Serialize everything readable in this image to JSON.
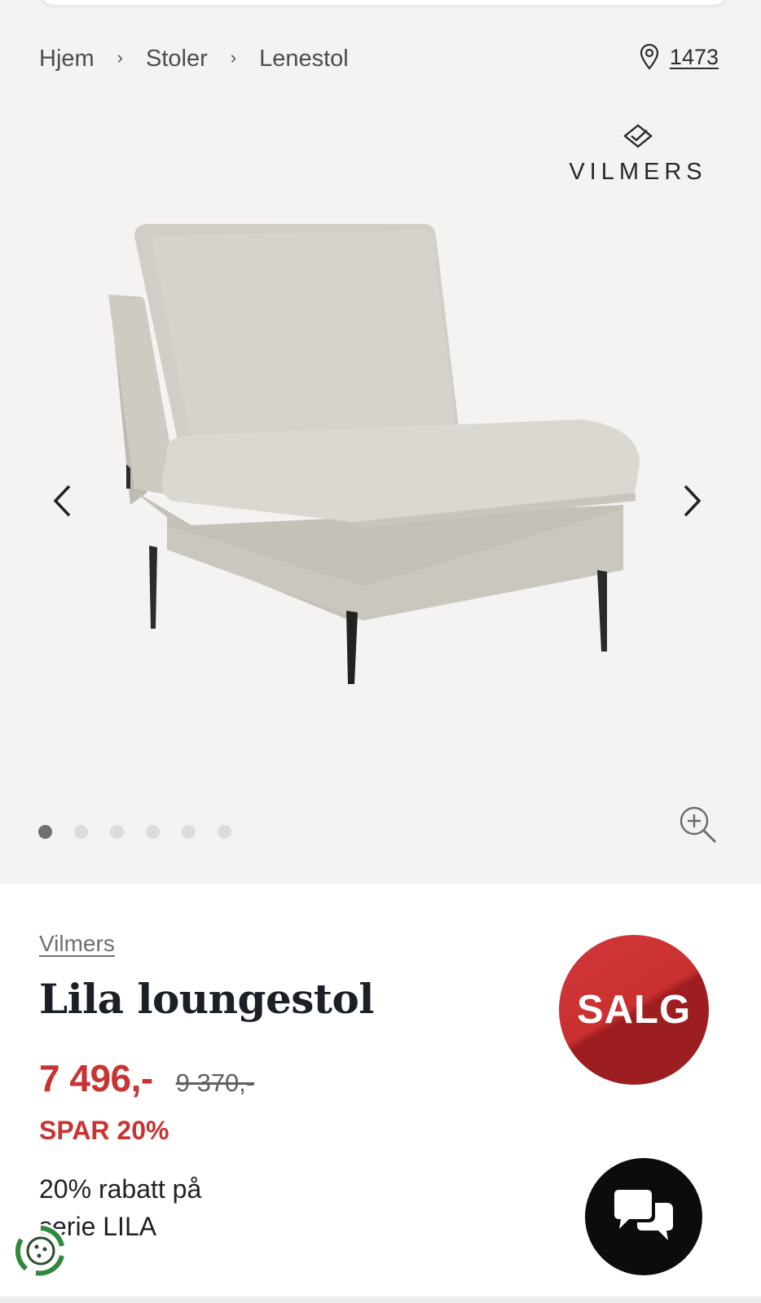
{
  "breadcrumb": {
    "items": [
      "Hjem",
      "Stoler",
      "Lenestol"
    ],
    "separator": "›"
  },
  "store": {
    "icon": "map-pin-icon",
    "number": "1473"
  },
  "gallery": {
    "brand_logo_text": "VILMERS",
    "prev_icon": "chevron-left-icon",
    "next_icon": "chevron-right-icon",
    "image_count": 6,
    "active_image_index": 1,
    "zoom_icon": "zoom-in-icon"
  },
  "product": {
    "brand": "Vilmers",
    "title": "Lila loungestol",
    "price_now": "7 496,-",
    "price_old": "9 370,-",
    "savings": "SPAR 20%",
    "promo_line1": "20% rabatt på",
    "promo_line2": "serie LILA",
    "sale_badge": "SALG"
  },
  "colors": {
    "sale_red": "#c83432",
    "gallery_bg": "#f4f3f1",
    "title": "#1b2027",
    "cookie_green": "#2f8a3e"
  },
  "widgets": {
    "chat_icon": "chat-bubbles-icon",
    "cookie_icon": "cookie-settings-icon"
  }
}
